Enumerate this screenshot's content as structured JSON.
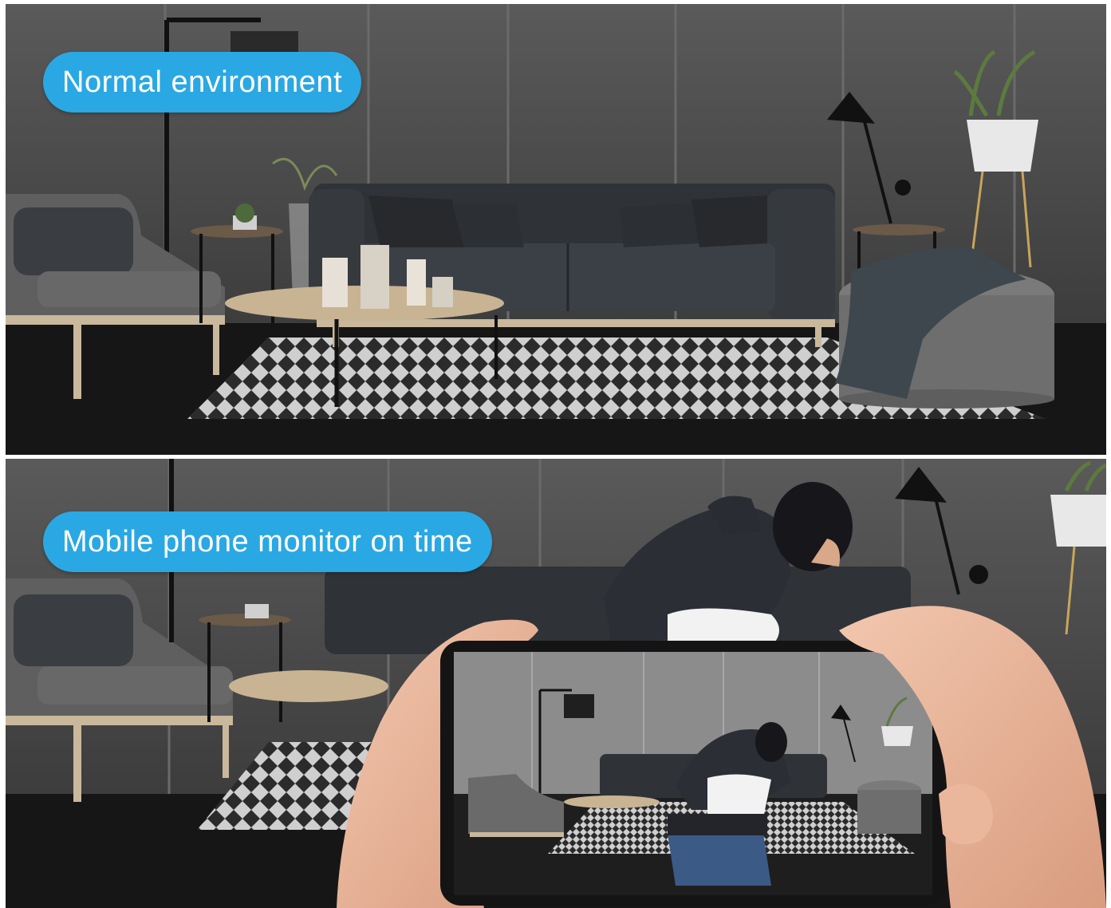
{
  "panels": {
    "top": {
      "caption": "Normal environment"
    },
    "bottom": {
      "caption": "Mobile phone monitor on time"
    }
  },
  "colors": {
    "caption_background": "#2aa8e3",
    "caption_text": "#ffffff",
    "wall": "#4a4a4a",
    "floor": "#141414"
  },
  "icons": [
    "floor-lamp-icon",
    "sofa-icon",
    "armchair-icon",
    "coffee-table-icon",
    "side-table-icon",
    "desk-lamp-icon",
    "plant-pot-icon",
    "pouf-icon",
    "rug-icon",
    "intruder-icon",
    "smartphone-icon",
    "hand-icon"
  ]
}
